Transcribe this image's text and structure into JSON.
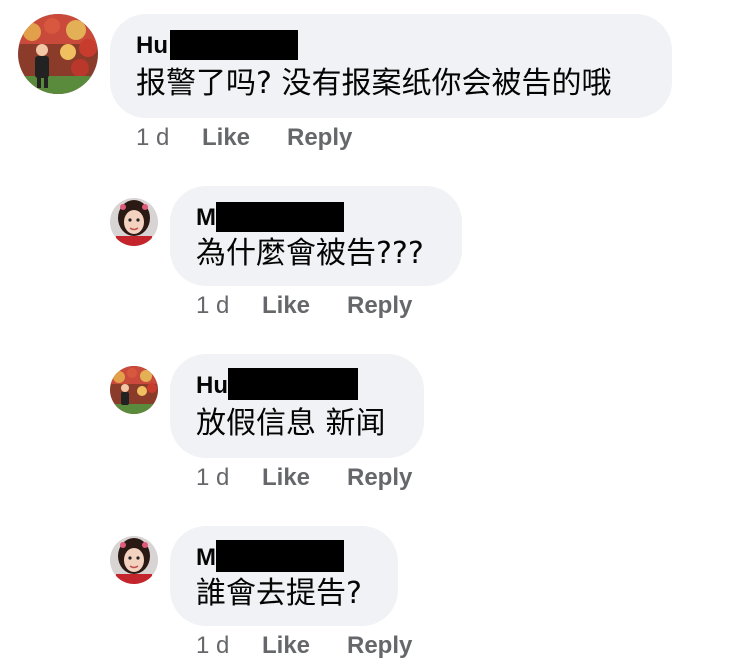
{
  "comments": [
    {
      "author": "Hu",
      "text": "报警了吗? 没有报案纸你会被告的哦",
      "time": "1 d",
      "like": "Like",
      "reply": "Reply",
      "avatar_icon": "profile-photo-red-wall"
    },
    {
      "author": "M",
      "text": "為什麼會被告???",
      "time": "1 d",
      "like": "Like",
      "reply": "Reply",
      "avatar_icon": "profile-photo-woman-red"
    },
    {
      "author": "Hu",
      "text": "放假信息 新闻",
      "time": "1 d",
      "like": "Like",
      "reply": "Reply",
      "avatar_icon": "profile-photo-red-wall"
    },
    {
      "author": "M",
      "text": "誰會去提告?",
      "time": "1 d",
      "like": "Like",
      "reply": "Reply",
      "avatar_icon": "profile-photo-woman-red"
    }
  ],
  "colors": {
    "bubble": "#f0f2f5",
    "meta_text": "#65676b",
    "redaction": "#000000"
  }
}
